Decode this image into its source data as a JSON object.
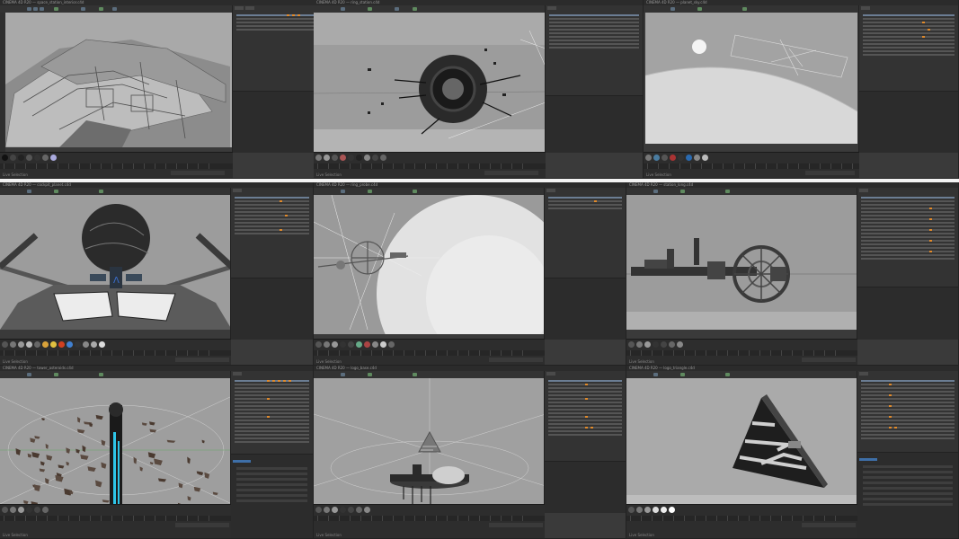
{
  "window": {
    "title_prefix": "Cinema 4D",
    "panels": [
      {
        "id": "p1",
        "title": "CINEMA 4D R20 — space_station_interior.c4d",
        "status": "Live Selection",
        "attrs": false
      },
      {
        "id": "p2",
        "title": "CINEMA 4D R20 — ring_station.c4d",
        "status": "Live Selection",
        "attrs": false
      },
      {
        "id": "p3",
        "title": "CINEMA 4D R20 — planet_sky.c4d",
        "status": "Live Selection",
        "attrs": false
      },
      {
        "id": "p4",
        "title": "CINEMA 4D R20 — cockpit_planet.c4d",
        "status": "Live Selection",
        "attrs": false
      },
      {
        "id": "p5",
        "title": "CINEMA 4D R20 — ring_probe.c4d",
        "status": "Live Selection",
        "attrs": false
      },
      {
        "id": "p6",
        "title": "CINEMA 4D R20 — station_long.c4d",
        "status": "Live Selection",
        "attrs": false
      },
      {
        "id": "p7",
        "title": "CINEMA 4D R20 — tower_asteroids.c4d",
        "status": "Live Selection",
        "attrs": true
      },
      {
        "id": "p8",
        "title": "CINEMA 4D R20 — logo_base.c4d",
        "status": "Live Selection",
        "attrs": false
      },
      {
        "id": "p9",
        "title": "CINEMA 4D R20 — logo_triangle.c4d",
        "status": "Live Selection",
        "attrs": true
      }
    ]
  },
  "colors": {
    "accent_orange": "#e08a2c",
    "viewport_gray": "#9f9f9f",
    "panel_bg": "#333333",
    "selection_blue": "#6b7d93"
  }
}
